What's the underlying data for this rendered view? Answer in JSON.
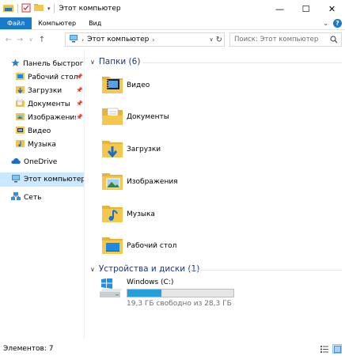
{
  "window": {
    "title": "Этот компьютер",
    "minimize": "—",
    "maximize": "☐",
    "close": "✕"
  },
  "ribbon": {
    "tabs": [
      "Файл",
      "Компьютер",
      "Вид"
    ]
  },
  "address": {
    "crumb": "Этот компьютер",
    "search_placeholder": "Поиск: Этот компьютер"
  },
  "sidebar": {
    "items": [
      {
        "label": "Панель быстрого доступа",
        "icon": "star-icon"
      },
      {
        "label": "Рабочий стол",
        "icon": "desktop-folder-icon",
        "pinned": true
      },
      {
        "label": "Загрузки",
        "icon": "downloads-folder-icon",
        "pinned": true
      },
      {
        "label": "Документы",
        "icon": "documents-folder-icon",
        "pinned": true
      },
      {
        "label": "Изображения",
        "icon": "pictures-folder-icon",
        "pinned": true
      },
      {
        "label": "Видео",
        "icon": "videos-folder-icon"
      },
      {
        "label": "Музыка",
        "icon": "music-folder-icon"
      },
      {
        "label": "OneDrive",
        "icon": "cloud-icon"
      },
      {
        "label": "Этот компьютер",
        "icon": "computer-icon",
        "selected": true
      },
      {
        "label": "Сеть",
        "icon": "network-icon"
      }
    ]
  },
  "main": {
    "folders_header": "Папки (6)",
    "folders": [
      {
        "label": "Видео",
        "icon": "videos-folder-icon"
      },
      {
        "label": "Документы",
        "icon": "documents-folder-icon"
      },
      {
        "label": "Загрузки",
        "icon": "downloads-folder-icon"
      },
      {
        "label": "Изображения",
        "icon": "pictures-folder-icon"
      },
      {
        "label": "Музыка",
        "icon": "music-folder-icon"
      },
      {
        "label": "Рабочий стол",
        "icon": "desktop-folder-icon"
      }
    ],
    "devices_header": "Устройства и диски (1)",
    "drive": {
      "name": "Windows (C:)",
      "free_text": "19,3 ГБ свободно из 28,3 ГБ",
      "used_fraction": 0.318
    }
  },
  "status": {
    "count": "Элементов: 7"
  },
  "colors": {
    "accent": "#1979ca",
    "group_header": "#1e3287",
    "selection": "#cce8ff",
    "drive_bar": "#26a0da"
  }
}
